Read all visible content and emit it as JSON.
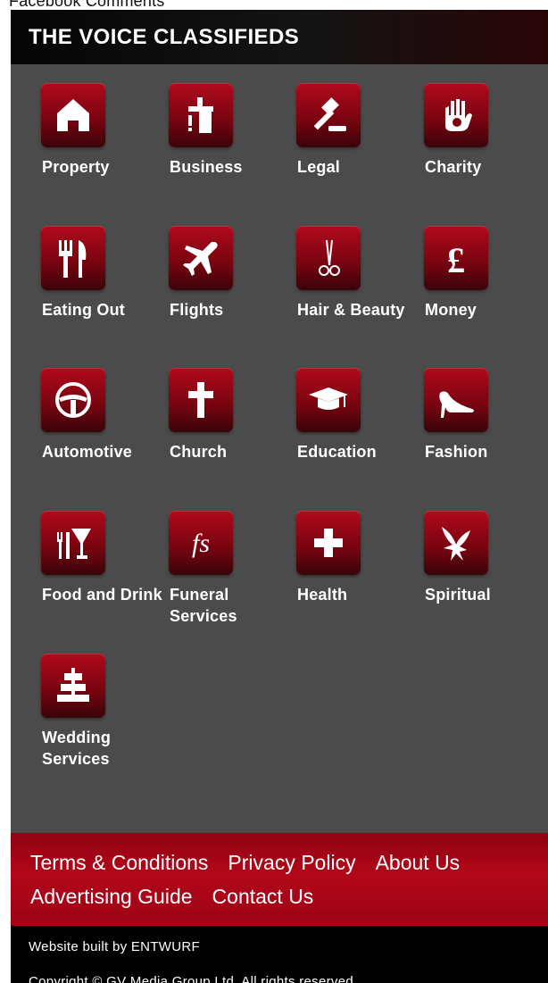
{
  "top_link": "Facebook Comments",
  "header": {
    "title": "THE VOICE CLASSIFIEDS"
  },
  "categories": [
    {
      "label": "Property",
      "icon": "house-icon"
    },
    {
      "label": "Business",
      "icon": "business-icon"
    },
    {
      "label": "Legal",
      "icon": "gavel-icon"
    },
    {
      "label": "Charity",
      "icon": "hand-icon"
    },
    {
      "label": "Eating Out",
      "icon": "cutlery-icon"
    },
    {
      "label": "Flights",
      "icon": "airplane-icon"
    },
    {
      "label": "Hair & Beauty",
      "icon": "scissors-icon"
    },
    {
      "label": "Money",
      "icon": "pound-icon"
    },
    {
      "label": "Automotive",
      "icon": "steering-wheel-icon"
    },
    {
      "label": "Church",
      "icon": "cross-icon"
    },
    {
      "label": "Education",
      "icon": "graduation-cap-icon"
    },
    {
      "label": "Fashion",
      "icon": "high-heel-icon"
    },
    {
      "label": "Food and Drink",
      "icon": "cocktail-icon"
    },
    {
      "label": "Funeral Services",
      "icon": "fs-icon"
    },
    {
      "label": "Health",
      "icon": "health-plus-icon"
    },
    {
      "label": "Spiritual",
      "icon": "dove-icon"
    },
    {
      "label": "Wedding Services",
      "icon": "wedding-cake-icon"
    }
  ],
  "footer": {
    "links": [
      "Terms & Conditions",
      "Privacy Policy",
      "About Us",
      "Advertising Guide",
      "Contact Us"
    ],
    "built_by": "Website built by ENTWURF",
    "copyright": "Copyright © GV Media Group Ltd. All rights reserved."
  },
  "colors": {
    "accent": "#a00a1a",
    "panel": "#4b4b4b"
  }
}
